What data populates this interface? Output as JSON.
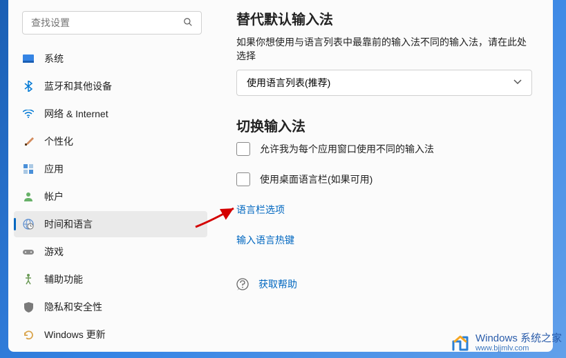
{
  "search": {
    "placeholder": "查找设置"
  },
  "sidebar": {
    "items": [
      {
        "label": "系统"
      },
      {
        "label": "蓝牙和其他设备"
      },
      {
        "label": "网络 & Internet"
      },
      {
        "label": "个性化"
      },
      {
        "label": "应用"
      },
      {
        "label": "帐户"
      },
      {
        "label": "时间和语言"
      },
      {
        "label": "游戏"
      },
      {
        "label": "辅助功能"
      },
      {
        "label": "隐私和安全性"
      },
      {
        "label": "Windows 更新"
      }
    ]
  },
  "content": {
    "section1_title": "替代默认输入法",
    "section1_sub": "如果你想使用与语言列表中最靠前的输入法不同的输入法，请在此处选择",
    "dropdown_value": "使用语言列表(推荐)",
    "section2_title": "切换输入法",
    "checkbox1": "允许我为每个应用窗口使用不同的输入法",
    "checkbox2": "使用桌面语言栏(如果可用)",
    "link1": "语言栏选项",
    "link2": "输入语言热键",
    "help": "获取帮助"
  },
  "watermark": {
    "line1": "Windows 系统之家",
    "line2": "www.bjjmlv.com"
  }
}
